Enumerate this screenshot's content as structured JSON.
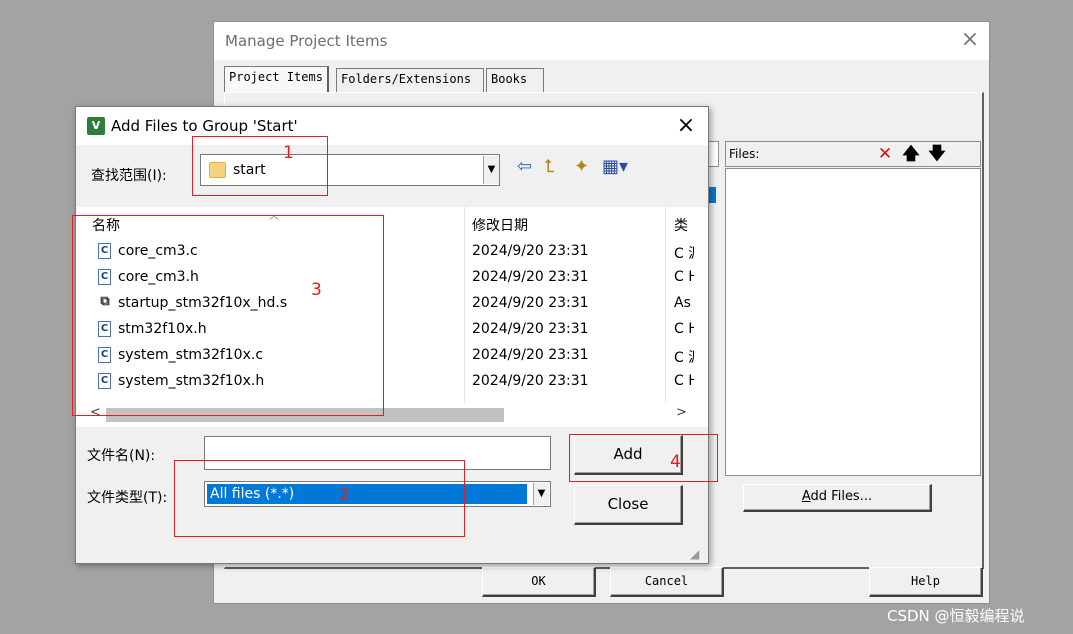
{
  "manage": {
    "title": "Manage Project Items",
    "close": "×",
    "tabs": [
      "Project Items",
      "Folders/Extensions",
      "Books"
    ],
    "files_label": "Files:",
    "add_files_prefix": "A",
    "add_files_rest": "dd Files...",
    "ok": "OK",
    "cancel": "Cancel",
    "help": "Help",
    "toolbar_icons": {
      "delete": "✕",
      "up": "🡅",
      "down": "🡇"
    }
  },
  "add_dialog": {
    "title": "Add Files to Group 'Start'",
    "app_icon_letter": "V",
    "close": "×",
    "look_in_label": "查找范围(I):",
    "look_in_value": "start",
    "columns": {
      "name": "名称",
      "date": "修改日期",
      "type": "类"
    },
    "files": [
      {
        "name": "core_cm3.c",
        "date": "2024/9/20 23:31",
        "type": "C 源",
        "icon": "C"
      },
      {
        "name": "core_cm3.h",
        "date": "2024/9/20 23:31",
        "type": "C H",
        "icon": "C"
      },
      {
        "name": "startup_stm32f10x_hd.s",
        "date": "2024/9/20 23:31",
        "type": "As",
        "icon": "asm"
      },
      {
        "name": "stm32f10x.h",
        "date": "2024/9/20 23:31",
        "type": "C H",
        "icon": "C"
      },
      {
        "name": "system_stm32f10x.c",
        "date": "2024/9/20 23:31",
        "type": "C 源",
        "icon": "C"
      },
      {
        "name": "system_stm32f10x.h",
        "date": "2024/9/20 23:31",
        "type": "C H",
        "icon": "C"
      }
    ],
    "file_name_label": "文件名(N):",
    "file_name_value": "",
    "file_type_label": "文件类型(T):",
    "file_type_value": "All files (*.*)",
    "add_button": "Add",
    "close_button": "Close"
  },
  "annotations": [
    "1",
    "2",
    "3",
    "4"
  ],
  "watermark": "CSDN @恒毅编程说",
  "colors": {
    "annotation": "#e02020",
    "selection": "#0078d7"
  }
}
